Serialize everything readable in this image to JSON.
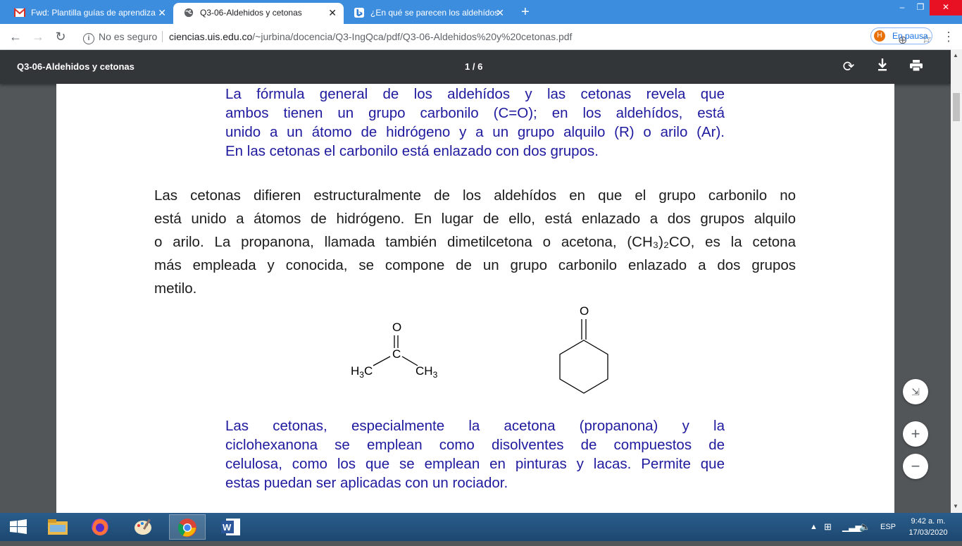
{
  "tabs": [
    {
      "title": "Fwd: Plantilla guías de aprendiza",
      "icon": "gmail-icon"
    },
    {
      "title": "Q3-06-Aldehidos y cetonas",
      "icon": "globe-icon"
    },
    {
      "title": "¿En qué se parecen los aldehídos",
      "icon": "bing-icon"
    }
  ],
  "window": {
    "minimize": "–",
    "restore": "❐",
    "close": "✕"
  },
  "nav": {
    "security_label": "No es seguro",
    "url_host": "ciencias.uis.edu.co",
    "url_path": "/~jurbina/docencia/Q3-IngQca/pdf/Q3-06-Aldehidos%20y%20cetonas.pdf",
    "profile_initial": "H",
    "profile_label": "En pausa"
  },
  "pdf": {
    "title": "Q3-06-Aldehidos y cetonas",
    "page_indicator": "1 / 6"
  },
  "document": {
    "para1_lines": [
      "La fórmula general de los aldehídos y las cetonas revela que",
      "ambos tienen un grupo carbonilo (C=O); en los aldehídos, está",
      "unido a un átomo de hidrógeno y a un grupo alquilo (R) o arilo (Ar).",
      "En las cetonas el carbonilo está enlazado con dos grupos."
    ],
    "para2_lines": [
      "Las cetonas difieren estructuralmente de los aldehídos en que el grupo carbonilo no",
      "está unido a átomos de hidrógeno. En lugar de ello, está enlazado a dos grupos alquilo",
      "o arilo. La propanona, llamada también dimetilcetona o acetona, (CH₃)₂CO, es la cetona",
      "más empleada y conocida, se compone de un grupo carbonilo enlazado a dos grupos",
      "metilo."
    ],
    "para3_lines": [
      "Las cetonas, especialmente la acetona (propanona) y la",
      "ciclohexanona se emplean como disolventes de compuestos de",
      "celulosa, como los que se emplean en pinturas y lacas. Permite que",
      "estas puedan ser aplicadas con un rociador."
    ],
    "acetone": {
      "o": "O",
      "c": "C",
      "left": "H",
      "left_sub": "3",
      "left_c": "C",
      "right": "CH",
      "right_sub": "3"
    },
    "cyclohexanone": {
      "o": "O"
    }
  },
  "taskbar": {
    "language": "ESP",
    "time": "9:42 a. m.",
    "date": "17/03/2020"
  }
}
